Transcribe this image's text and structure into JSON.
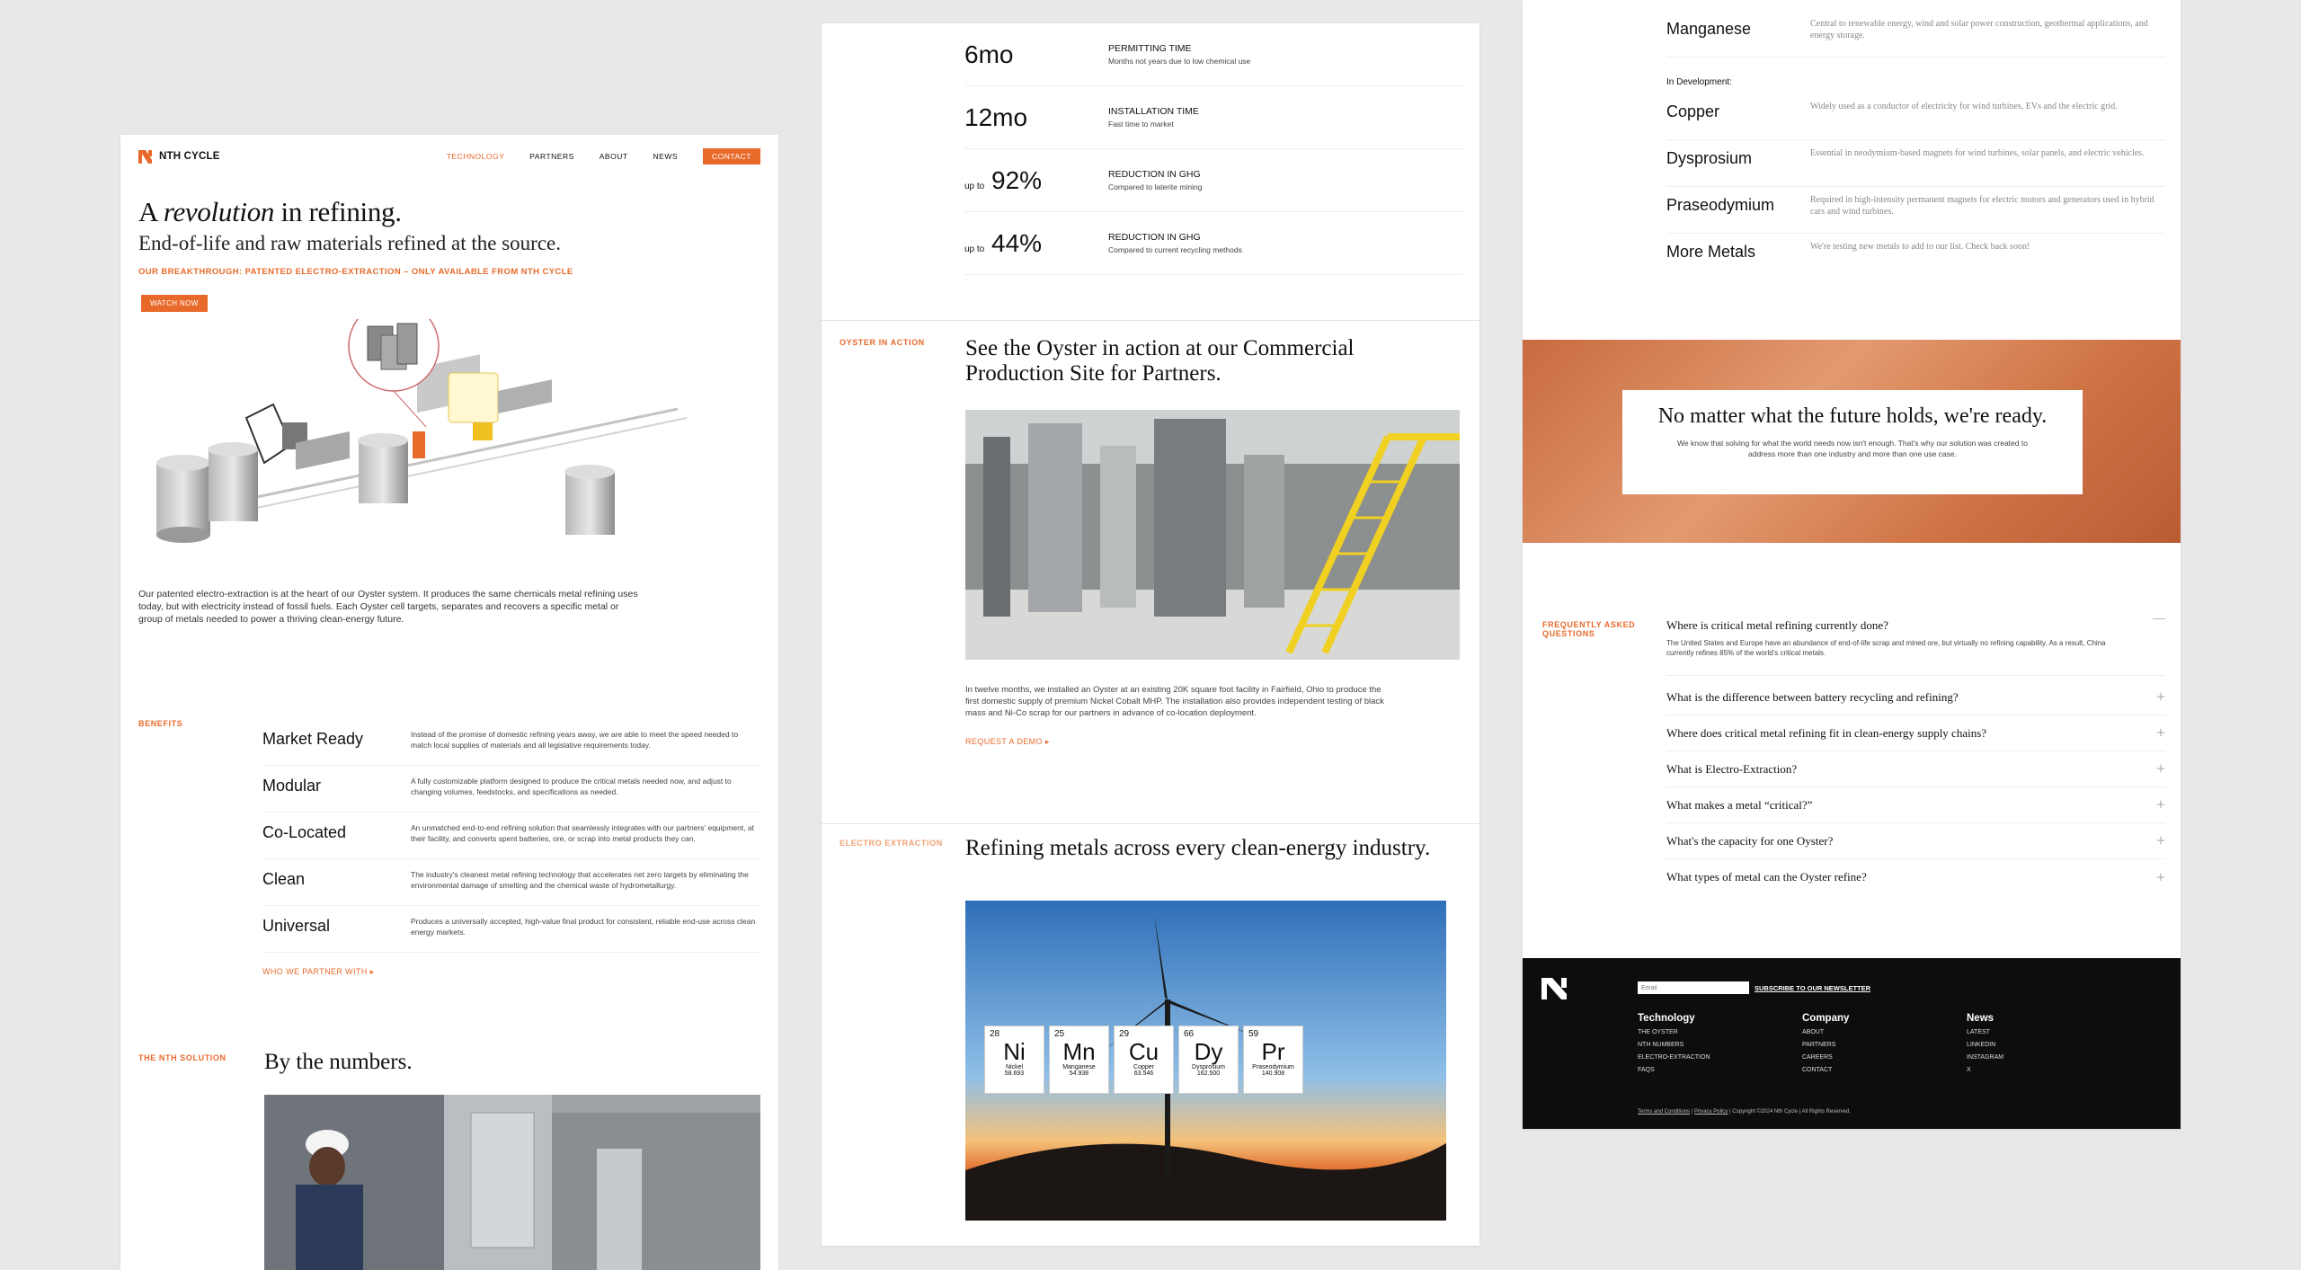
{
  "colors": {
    "accent": "#e86a2b",
    "footer_bg": "#0d0d0d",
    "hero_band": "#d9825a"
  },
  "panel1": {
    "brand": "NTH CYCLE",
    "nav": {
      "technology": "TECHNOLOGY",
      "partners": "PARTNERS",
      "about": "ABOUT",
      "news": "NEWS",
      "contact": "CONTACT"
    },
    "headline_pre": "A ",
    "headline_em": "revolution",
    "headline_post": " in refining.",
    "subheadline": "End-of-life and raw materials refined at the source.",
    "tagline": "OUR BREAKTHROUGH: PATENTED ELECTRO-EXTRACTION – ONLY AVAILABLE FROM NTH CYCLE",
    "watch_button": "WATCH NOW",
    "description": "Our patented electro-extraction is at the heart of our Oyster system. It produces the same chemicals metal refining uses today, but with electricity instead of fossil fuels. Each Oyster cell targets, separates and recovers a specific metal or group of metals needed to power a thriving clean-energy future.",
    "benefits_label": "BENEFITS",
    "benefits": [
      {
        "title": "Market Ready",
        "desc": "Instead of the promise of domestic refining years away, we are able to meet the speed needed to match local supplies of materials and all legislative requirements today."
      },
      {
        "title": "Modular",
        "desc": "A fully customizable platform designed to produce the critical metals needed now, and adjust to changing volumes, feedstocks, and specifications as needed."
      },
      {
        "title": "Co-Located",
        "desc": "An unmatched end-to-end refining solution that seamlessly integrates with our partners' equipment, at their facility, and converts spent batteries, ore, or scrap into metal products they can."
      },
      {
        "title": "Clean",
        "desc": "The industry's cleanest metal refining technology that accelerates net zero targets by eliminating the environmental damage of smelting and the chemical waste of hydrometallurgy."
      },
      {
        "title": "Universal",
        "desc": "Produces a universally accepted, high-value final product for consistent, reliable end-use across clean energy markets."
      }
    ],
    "partner_link": "WHO WE PARTNER WITH ▸",
    "solution_label": "THE NTH SOLUTION",
    "numbers_title": "By the numbers."
  },
  "panel2": {
    "stats": [
      {
        "prefix": "",
        "value": "6mo",
        "title": "PERMITTING TIME",
        "sub": "Months not years due to low chemical use"
      },
      {
        "prefix": "",
        "value": "12mo",
        "title": "INSTALLATION TIME",
        "sub": "Fast time to market"
      },
      {
        "prefix": "up to",
        "value": "92%",
        "title": "REDUCTION IN GHG",
        "sub": "Compared to laterite mining"
      },
      {
        "prefix": "up to",
        "value": "44%",
        "title": "REDUCTION IN GHG",
        "sub": "Compared to current recycling methods"
      }
    ],
    "oyster_label": "OYSTER IN ACTION",
    "oyster_title": "See the Oyster in action at our Commercial Production Site for Partners.",
    "oyster_desc": "In twelve months, we installed an Oyster at an existing 20K square foot facility in Fairfield, Ohio to produce the first domestic supply of premium Nickel Cobalt MHP. The installation also provides independent testing of black mass and Ni-Co scrap for our partners in advance of co-location deployment.",
    "demo_link": "REQUEST A DEMO ▸",
    "electro_label": "ELECTRO EXTRACTION",
    "electro_title": "Refining metals across every clean-energy industry.",
    "elements": [
      {
        "num": "28",
        "sym": "Ni",
        "name": "Nickel",
        "mass": "58.693"
      },
      {
        "num": "25",
        "sym": "Mn",
        "name": "Manganese",
        "mass": "54.938"
      },
      {
        "num": "29",
        "sym": "Cu",
        "name": "Copper",
        "mass": "63.546"
      },
      {
        "num": "66",
        "sym": "Dy",
        "name": "Dysprosium",
        "mass": "162.500"
      },
      {
        "num": "59",
        "sym": "Pr",
        "name": "Praseodymium",
        "mass": "140.908"
      }
    ]
  },
  "panel3": {
    "metal_top": {
      "name": "Manganese",
      "desc": "Central to renewable energy, wind and solar power construction, geothermal applications, and energy storage."
    },
    "dev_label": "In Development:",
    "metals": [
      {
        "name": "Copper",
        "desc": "Widely used as a conductor of electricity for wind turbines, EVs and the electric grid."
      },
      {
        "name": "Dysprosium",
        "desc": "Essential in neodymium-based magnets for wind turbines, solar panels, and electric vehicles."
      },
      {
        "name": "Praseodymium",
        "desc": "Required in high-intensity permanent magnets for electric motors and generators used in hybrid cars and wind turbines."
      },
      {
        "name": "More Metals",
        "desc": "We're testing new metals to add to our list. Check back soon!"
      }
    ],
    "ready_title": "No matter what the future holds, we're ready.",
    "ready_desc": "We know that solving for what the world needs now isn't enough. That's why our solution was created to address more than one industry and more than one use case.",
    "faq_label": "FREQUENTLY ASKED QUESTIONS",
    "faq_open_q": "Where is critical metal refining currently done?",
    "faq_open_a": "The United States and Europe have an abundance of end-of-life scrap and mined ore, but virtually no refining capability. As a result, China currently refines 85% of the world's critical metals.",
    "faqs": [
      "What is the difference between battery recycling and refining?",
      "Where does critical metal refining fit in clean-energy supply chains?",
      "What is Electro-Extraction?",
      "What makes a metal “critical?”",
      "What's the capacity for one Oyster?",
      "What types of metal can the Oyster refine?"
    ],
    "footer": {
      "email_placeholder": "Email",
      "subscribe": "SUBSCRIBE TO OUR NEWSLETTER",
      "cols": [
        {
          "title": "Technology",
          "items": [
            "THE OYSTER",
            "NTH NUMBERS",
            "ELECTRO-EXTRACTION",
            "FAQS"
          ]
        },
        {
          "title": "Company",
          "items": [
            "ABOUT",
            "PARTNERS",
            "CAREERS",
            "CONTACT"
          ]
        },
        {
          "title": "News",
          "items": [
            "LATEST",
            "LINKEDIN",
            "INSTAGRAM",
            "X"
          ]
        }
      ],
      "terms": "Terms and Conditions",
      "privacy": "Privacy Policy",
      "copyright": "Copyright ©2024 Nth Cycle | All Rights Reserved."
    }
  }
}
